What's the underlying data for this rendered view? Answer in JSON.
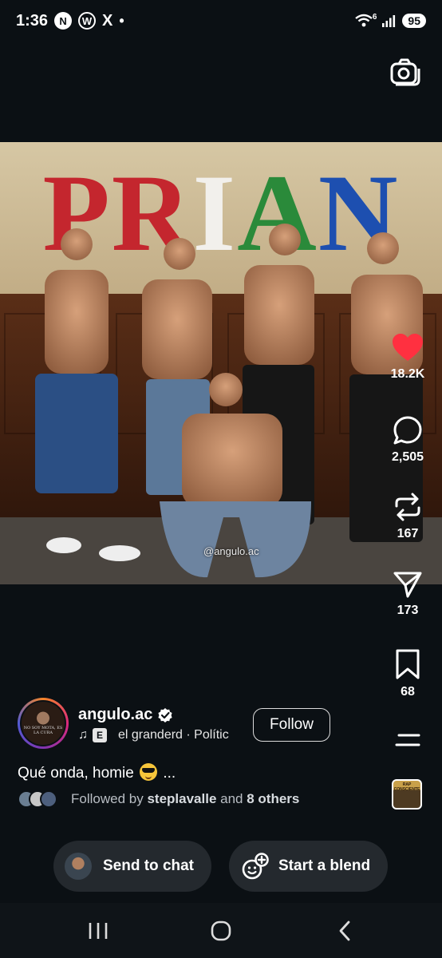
{
  "status_bar": {
    "time": "1:36",
    "notif_icons": [
      "N",
      "W",
      "X"
    ],
    "dot": "•",
    "network": "6",
    "battery": "95"
  },
  "media": {
    "watermark": "@angulo.ac",
    "wall_text": "PRIAN",
    "letter_colors": [
      "#c4262e",
      "#f2f0ec",
      "#2a8a3a",
      "#1d4fb0"
    ]
  },
  "actions": {
    "likes": "18.2K",
    "comments": "2,505",
    "reposts": "167",
    "shares": "173",
    "saves": "68",
    "like_color": "#ff3040"
  },
  "post": {
    "avatar_text": "NO SOY MOTA, ES LA CURA",
    "username": "angulo.ac",
    "explicit": "E",
    "music": "el granderd · Polític",
    "follow_label": "Follow",
    "caption_start": "Qué onda, homie",
    "caption_more": "...",
    "followed_prefix": "Followed by",
    "followed_user": "steplavalle",
    "followed_and": "and",
    "followed_others": "8 others"
  },
  "audio_thumb": {
    "text": "RAP CONSCIENTE"
  },
  "bottom_actions": {
    "send_to_chat": "Send to chat",
    "start_blend": "Start a blend"
  },
  "nav": {
    "buttons": [
      "recents",
      "home",
      "back"
    ]
  }
}
